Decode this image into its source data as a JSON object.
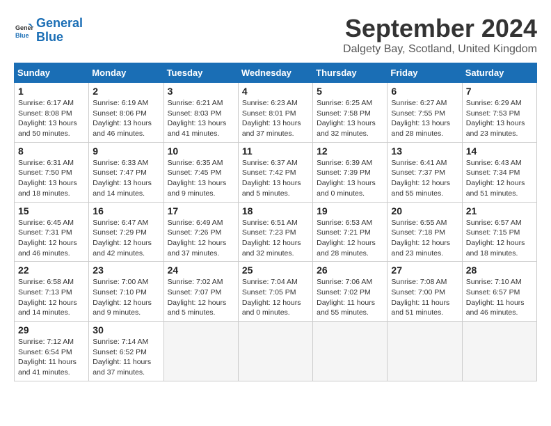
{
  "header": {
    "logo_line1": "General",
    "logo_line2": "Blue",
    "title": "September 2024",
    "subtitle": "Dalgety Bay, Scotland, United Kingdom"
  },
  "columns": [
    "Sunday",
    "Monday",
    "Tuesday",
    "Wednesday",
    "Thursday",
    "Friday",
    "Saturday"
  ],
  "weeks": [
    [
      {
        "day": "1",
        "info": "Sunrise: 6:17 AM\nSunset: 8:08 PM\nDaylight: 13 hours\nand 50 minutes."
      },
      {
        "day": "2",
        "info": "Sunrise: 6:19 AM\nSunset: 8:06 PM\nDaylight: 13 hours\nand 46 minutes."
      },
      {
        "day": "3",
        "info": "Sunrise: 6:21 AM\nSunset: 8:03 PM\nDaylight: 13 hours\nand 41 minutes."
      },
      {
        "day": "4",
        "info": "Sunrise: 6:23 AM\nSunset: 8:01 PM\nDaylight: 13 hours\nand 37 minutes."
      },
      {
        "day": "5",
        "info": "Sunrise: 6:25 AM\nSunset: 7:58 PM\nDaylight: 13 hours\nand 32 minutes."
      },
      {
        "day": "6",
        "info": "Sunrise: 6:27 AM\nSunset: 7:55 PM\nDaylight: 13 hours\nand 28 minutes."
      },
      {
        "day": "7",
        "info": "Sunrise: 6:29 AM\nSunset: 7:53 PM\nDaylight: 13 hours\nand 23 minutes."
      }
    ],
    [
      {
        "day": "8",
        "info": "Sunrise: 6:31 AM\nSunset: 7:50 PM\nDaylight: 13 hours\nand 18 minutes."
      },
      {
        "day": "9",
        "info": "Sunrise: 6:33 AM\nSunset: 7:47 PM\nDaylight: 13 hours\nand 14 minutes."
      },
      {
        "day": "10",
        "info": "Sunrise: 6:35 AM\nSunset: 7:45 PM\nDaylight: 13 hours\nand 9 minutes."
      },
      {
        "day": "11",
        "info": "Sunrise: 6:37 AM\nSunset: 7:42 PM\nDaylight: 13 hours\nand 5 minutes."
      },
      {
        "day": "12",
        "info": "Sunrise: 6:39 AM\nSunset: 7:39 PM\nDaylight: 13 hours\nand 0 minutes."
      },
      {
        "day": "13",
        "info": "Sunrise: 6:41 AM\nSunset: 7:37 PM\nDaylight: 12 hours\nand 55 minutes."
      },
      {
        "day": "14",
        "info": "Sunrise: 6:43 AM\nSunset: 7:34 PM\nDaylight: 12 hours\nand 51 minutes."
      }
    ],
    [
      {
        "day": "15",
        "info": "Sunrise: 6:45 AM\nSunset: 7:31 PM\nDaylight: 12 hours\nand 46 minutes."
      },
      {
        "day": "16",
        "info": "Sunrise: 6:47 AM\nSunset: 7:29 PM\nDaylight: 12 hours\nand 42 minutes."
      },
      {
        "day": "17",
        "info": "Sunrise: 6:49 AM\nSunset: 7:26 PM\nDaylight: 12 hours\nand 37 minutes."
      },
      {
        "day": "18",
        "info": "Sunrise: 6:51 AM\nSunset: 7:23 PM\nDaylight: 12 hours\nand 32 minutes."
      },
      {
        "day": "19",
        "info": "Sunrise: 6:53 AM\nSunset: 7:21 PM\nDaylight: 12 hours\nand 28 minutes."
      },
      {
        "day": "20",
        "info": "Sunrise: 6:55 AM\nSunset: 7:18 PM\nDaylight: 12 hours\nand 23 minutes."
      },
      {
        "day": "21",
        "info": "Sunrise: 6:57 AM\nSunset: 7:15 PM\nDaylight: 12 hours\nand 18 minutes."
      }
    ],
    [
      {
        "day": "22",
        "info": "Sunrise: 6:58 AM\nSunset: 7:13 PM\nDaylight: 12 hours\nand 14 minutes."
      },
      {
        "day": "23",
        "info": "Sunrise: 7:00 AM\nSunset: 7:10 PM\nDaylight: 12 hours\nand 9 minutes."
      },
      {
        "day": "24",
        "info": "Sunrise: 7:02 AM\nSunset: 7:07 PM\nDaylight: 12 hours\nand 5 minutes."
      },
      {
        "day": "25",
        "info": "Sunrise: 7:04 AM\nSunset: 7:05 PM\nDaylight: 12 hours\nand 0 minutes."
      },
      {
        "day": "26",
        "info": "Sunrise: 7:06 AM\nSunset: 7:02 PM\nDaylight: 11 hours\nand 55 minutes."
      },
      {
        "day": "27",
        "info": "Sunrise: 7:08 AM\nSunset: 7:00 PM\nDaylight: 11 hours\nand 51 minutes."
      },
      {
        "day": "28",
        "info": "Sunrise: 7:10 AM\nSunset: 6:57 PM\nDaylight: 11 hours\nand 46 minutes."
      }
    ],
    [
      {
        "day": "29",
        "info": "Sunrise: 7:12 AM\nSunset: 6:54 PM\nDaylight: 11 hours\nand 41 minutes."
      },
      {
        "day": "30",
        "info": "Sunrise: 7:14 AM\nSunset: 6:52 PM\nDaylight: 11 hours\nand 37 minutes."
      },
      {
        "day": "",
        "info": ""
      },
      {
        "day": "",
        "info": ""
      },
      {
        "day": "",
        "info": ""
      },
      {
        "day": "",
        "info": ""
      },
      {
        "day": "",
        "info": ""
      }
    ]
  ]
}
